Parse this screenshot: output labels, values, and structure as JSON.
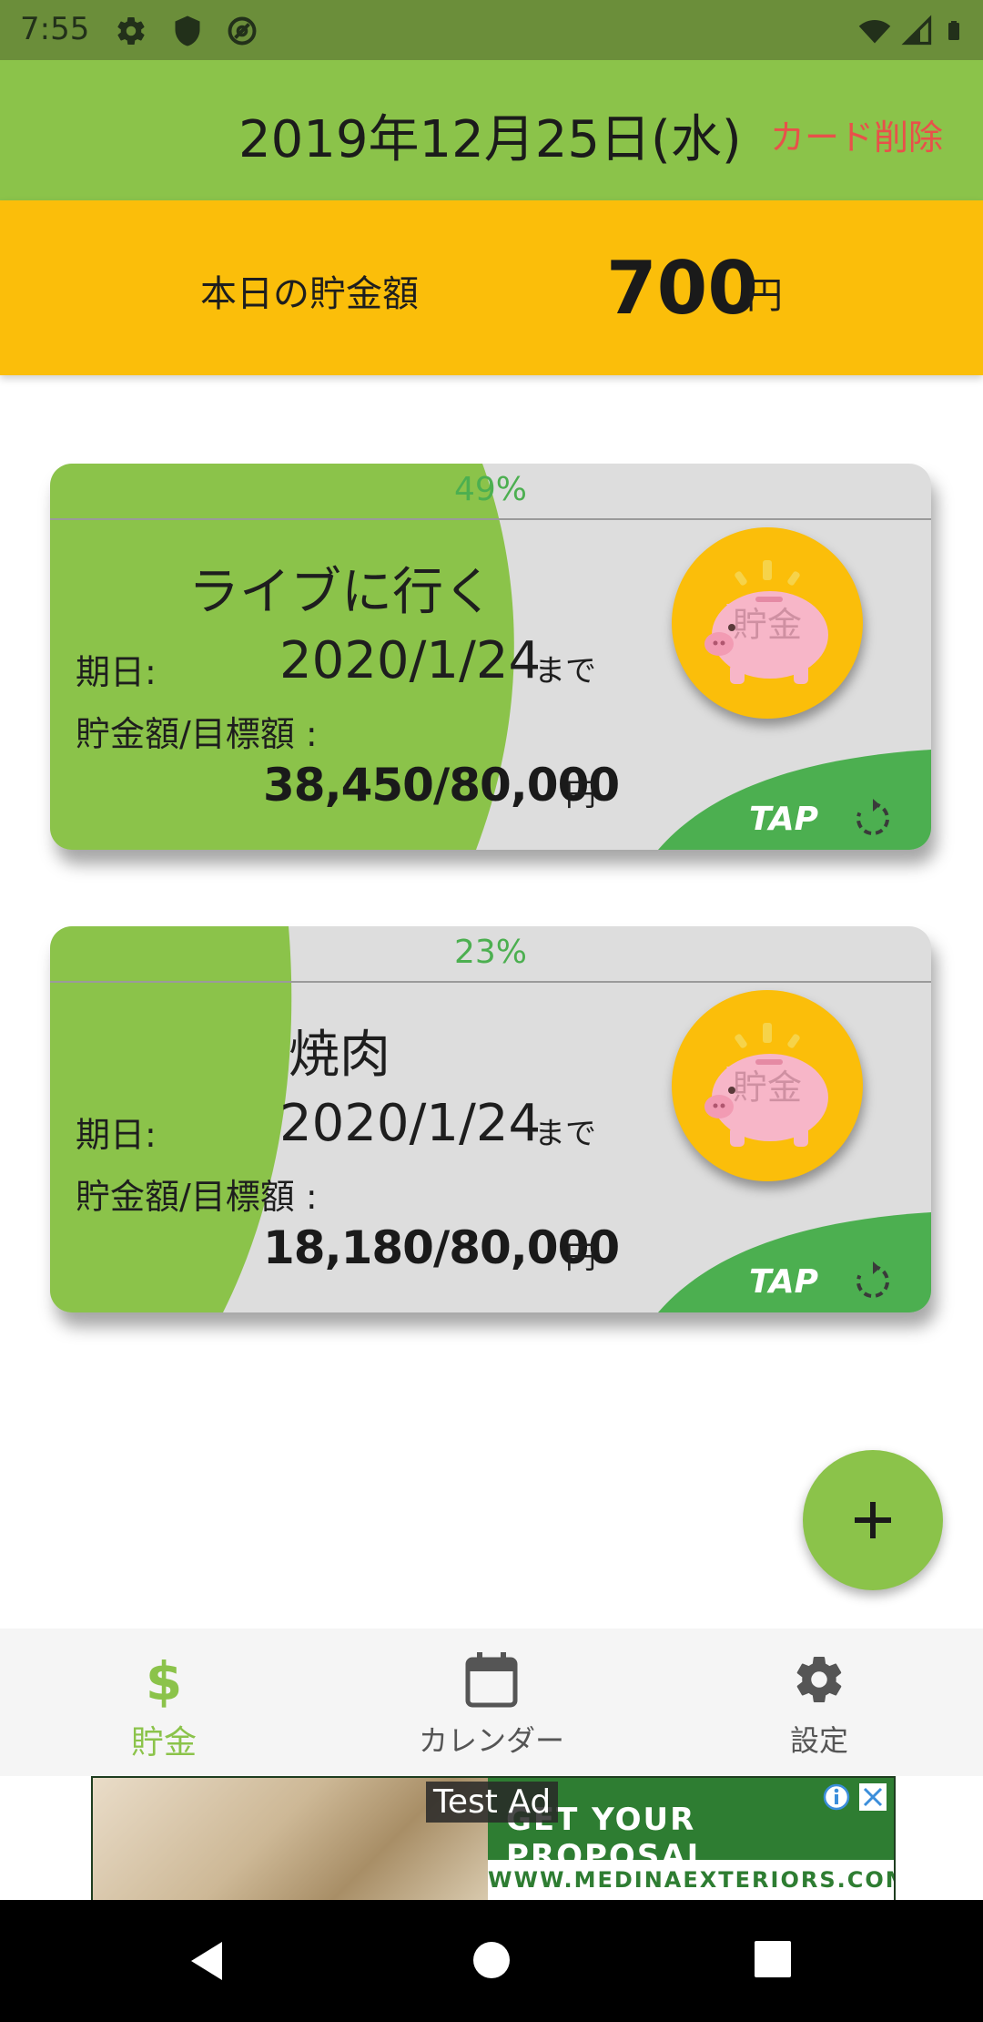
{
  "status_bar": {
    "time": "7:55"
  },
  "header": {
    "date": "2019年12月25日(水)",
    "delete_label": "カード削除"
  },
  "today": {
    "label": "本日の貯金額",
    "amount": "700",
    "unit": "円"
  },
  "cards": [
    {
      "percent_label": "49%",
      "progress": 0.49,
      "title": "ライブに行く",
      "due_label": "期日:",
      "due_date": "2020/1/24",
      "due_suffix": "まで",
      "amount_label": "貯金額/目標額 :",
      "amount": "38,450/80,000",
      "amount_unit": "円",
      "piggy_label": "貯金",
      "tap_label": "TAP"
    },
    {
      "percent_label": "23%",
      "progress": 0.23,
      "title": "焼肉",
      "due_label": "期日:",
      "due_date": "2020/1/24",
      "due_suffix": "まで",
      "amount_label": "貯金額/目標額 :",
      "amount": "18,180/80,000",
      "amount_unit": "円",
      "piggy_label": "貯金",
      "tap_label": "TAP"
    }
  ],
  "fab": {
    "icon": "plus-icon"
  },
  "bottom_nav": {
    "items": [
      {
        "label": "貯金",
        "icon": "dollar-icon",
        "active": true
      },
      {
        "label": "カレンダー",
        "icon": "calendar-icon",
        "active": false
      },
      {
        "label": "設定",
        "icon": "gear-icon",
        "active": false
      }
    ]
  },
  "ad": {
    "label": "Test Ad",
    "banner_text": "GET YOUR PROPOSAL",
    "url_text": "WWW.MEDINAEXTERIORS.COM"
  },
  "colors": {
    "header": "#8bc34a",
    "today_bg": "#fbbe0a",
    "progress_green": "#8bc34a",
    "accent_green": "#4caf50",
    "delete_red": "#e8514a"
  }
}
